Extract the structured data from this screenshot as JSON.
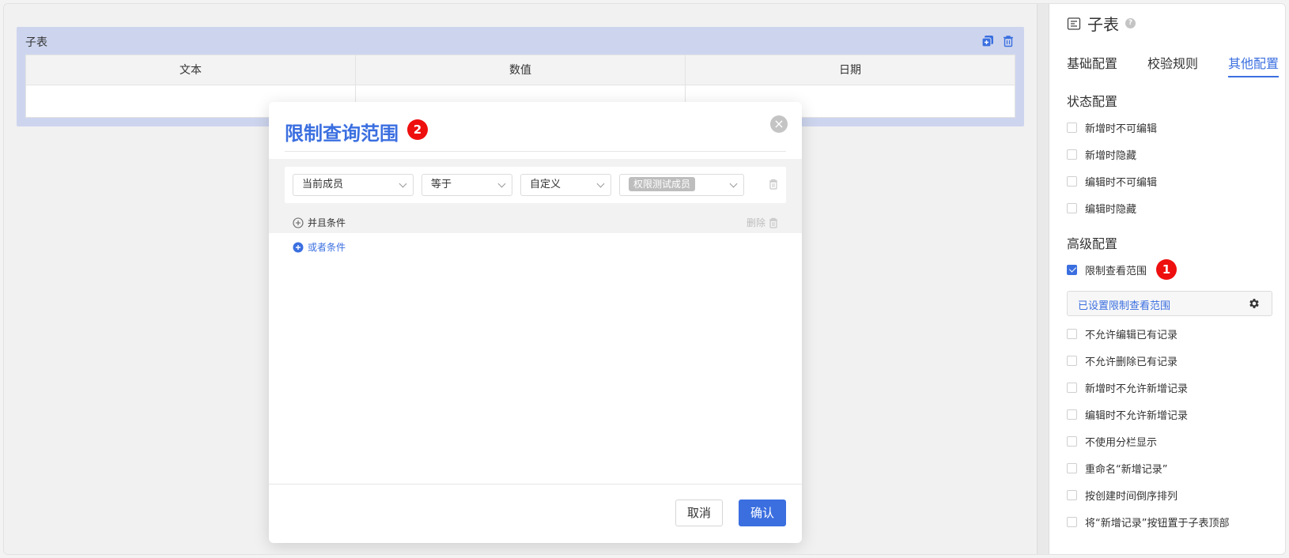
{
  "canvas": {
    "subtable": {
      "title": "子表",
      "columns": [
        "文本",
        "数值",
        "日期"
      ]
    }
  },
  "dialog": {
    "title": "限制查询范围",
    "badge": "2",
    "close_icon": "×",
    "condition": {
      "field": "当前成员",
      "operator": "等于",
      "mode": "自定义",
      "value_tag": "权限测试成员"
    },
    "and_condition": "并且条件",
    "delete": "删除",
    "or_condition": "或者条件",
    "cancel": "取消",
    "confirm": "确认"
  },
  "panel": {
    "title": "子表",
    "tabs": [
      "基础配置",
      "校验规则",
      "其他配置"
    ],
    "active_tab": 2,
    "status_section": "状态配置",
    "status_options": [
      "新增时不可编辑",
      "新增时隐藏",
      "编辑时不可编辑",
      "编辑时隐藏"
    ],
    "advanced_section": "高级配置",
    "limit_option": "限制查看范围",
    "limit_badge": "1",
    "range_text": "已设置限制查看范围",
    "advanced_options": [
      "不允许编辑已有记录",
      "不允许删除已有记录",
      "新增时不允许新增记录",
      "编辑时不允许新增记录",
      "不使用分栏显示",
      "重命名“新增记录”",
      "按创建时间倒序排列",
      "将“新增记录”按钮置于子表顶部"
    ]
  },
  "colors": {
    "accent": "#3b6fe0",
    "badge": "#ee0f0f",
    "subtable_bg": "#cdd5ee"
  }
}
